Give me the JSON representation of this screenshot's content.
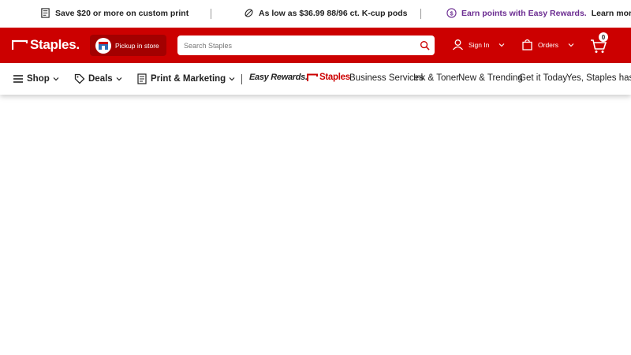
{
  "promo": {
    "item1": "Save $20 or more on custom print",
    "item2": "As low as $36.99 88/96 ct. K-cup pods",
    "item3": "Earn points with Easy Rewards.",
    "item3_link": "Learn more"
  },
  "header": {
    "logo": "Staples.",
    "pickup_label": "Pickup in store",
    "search_placeholder": "Search Staples",
    "signin_label": "Sign In",
    "orders_label": "Orders",
    "cart_count": "0"
  },
  "nav": {
    "shop": "Shop",
    "deals": "Deals",
    "print": "Print & Marketing",
    "easy_rewards": "Easy Rewards.",
    "staples_brand": "Staples",
    "links": [
      "Business Services",
      "Ink & Toner",
      "New & Trending",
      "Get it Today",
      "Yes, Staples has"
    ]
  },
  "colors": {
    "brand_red": "#cc0000",
    "dark_red": "#a30000",
    "rewards_purple": "#6b2c91"
  }
}
